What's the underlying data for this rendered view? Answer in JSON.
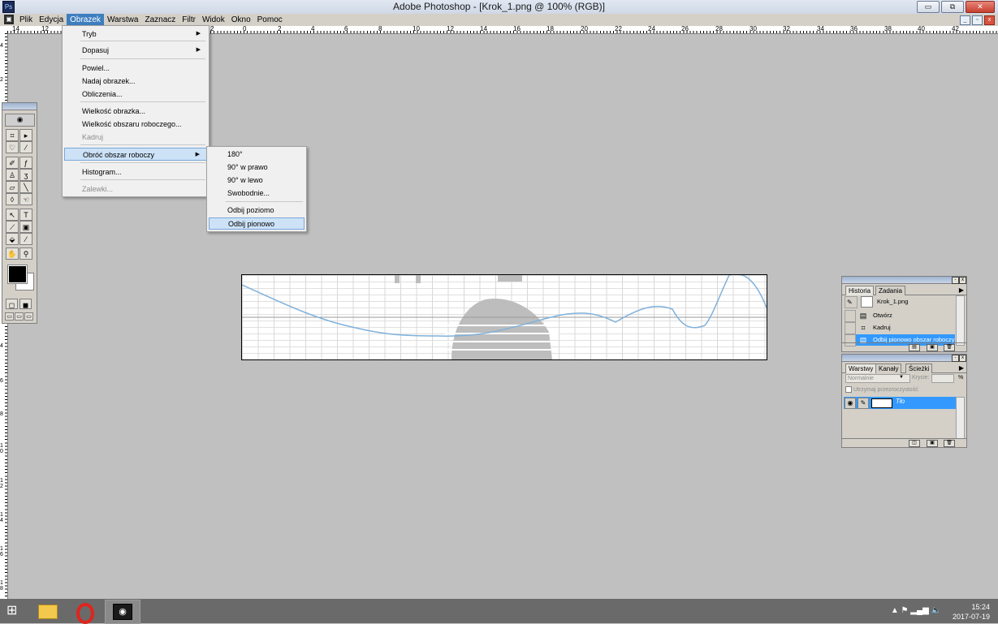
{
  "window": {
    "title": "Adobe Photoshop - [Krok_1.png @ 100% (RGB)]",
    "minimize": "▭",
    "maximize": "⧉",
    "close": "✕"
  },
  "menubar": {
    "items": [
      "Plik",
      "Edycja",
      "Obrazek",
      "Warstwa",
      "Zaznacz",
      "Filtr",
      "Widok",
      "Okno",
      "Pomoc"
    ],
    "active": "Obrazek"
  },
  "ruler": {
    "top_labels": [
      "14",
      "12",
      "2",
      "0",
      "2",
      "4",
      "6",
      "8",
      "10",
      "12",
      "14",
      "16",
      "18",
      "20",
      "22",
      "24",
      "26",
      "28",
      "30",
      "32",
      "34",
      "36",
      "38",
      "40",
      "42"
    ],
    "left_labels": [
      "4",
      "2",
      "4",
      "6",
      "8",
      "10",
      "12",
      "14",
      "16",
      "18"
    ]
  },
  "image_menu": {
    "items": [
      {
        "label": "Tryb",
        "submenu": true
      },
      {
        "label": "Dopasuj",
        "submenu": true
      },
      {
        "label": "Powiel..."
      },
      {
        "label": "Nadaj obrazek..."
      },
      {
        "label": "Obliczenia..."
      },
      {
        "label": "Wielkość obrazka..."
      },
      {
        "label": "Wielkość obszaru roboczego..."
      },
      {
        "label": "Kadruj",
        "disabled": true
      },
      {
        "label": "Obróć obszar roboczy",
        "submenu": true,
        "highlighted": true
      },
      {
        "label": "Histogram..."
      },
      {
        "label": "Zalewki...",
        "disabled": true
      }
    ]
  },
  "rotate_submenu": {
    "items": [
      {
        "label": "180°"
      },
      {
        "label": "90° w prawo"
      },
      {
        "label": "90° w lewo"
      },
      {
        "label": "Swobodnie..."
      },
      {
        "label": "Odbij poziomo"
      },
      {
        "label": "Odbij pionowo",
        "highlighted": true
      }
    ]
  },
  "toolbox": {
    "tools": [
      "crop-icon",
      "move-icon",
      "lasso-icon",
      "magic-wand-icon",
      "airbrush-icon",
      "paintbrush-icon",
      "stamp-icon",
      "history-brush-icon",
      "eraser-icon",
      "line-icon",
      "blur-icon",
      "smudge-icon",
      "pen-icon",
      "type-icon",
      "measure-icon",
      "gradient-icon",
      "bucket-icon",
      "eyedropper-icon",
      "hand-icon",
      "zoom-icon"
    ],
    "foreground_color": "#000000",
    "background_color": "#ffffff"
  },
  "history_panel": {
    "tabs": [
      "Historia",
      "Zadania"
    ],
    "snapshot": "Krok_1.png",
    "steps": [
      {
        "label": "Otwórz",
        "icon": "document-icon"
      },
      {
        "label": "Kadruj",
        "icon": "crop-icon"
      },
      {
        "label": "Odbij pionowo obszar roboczy",
        "icon": "document-icon",
        "selected": true
      }
    ]
  },
  "layers_panel": {
    "tabs": [
      "Warstwy",
      "Kanały",
      "Ścieżki"
    ],
    "blend_mode": "Normalnie",
    "opacity_label": "Krycie:",
    "opacity_unit": "%",
    "preserve_label": "Utrzymaj przezroczystość",
    "layer_name": "Tło"
  },
  "taskbar": {
    "clock_time": "15:24",
    "clock_date": "2017-07-19",
    "tray": "▲  ⚑  ▂▄▆  🔈"
  },
  "colors": {
    "accent": "#3d7ebf",
    "selection": "#3399ff",
    "curve": "#7fb1dc"
  }
}
